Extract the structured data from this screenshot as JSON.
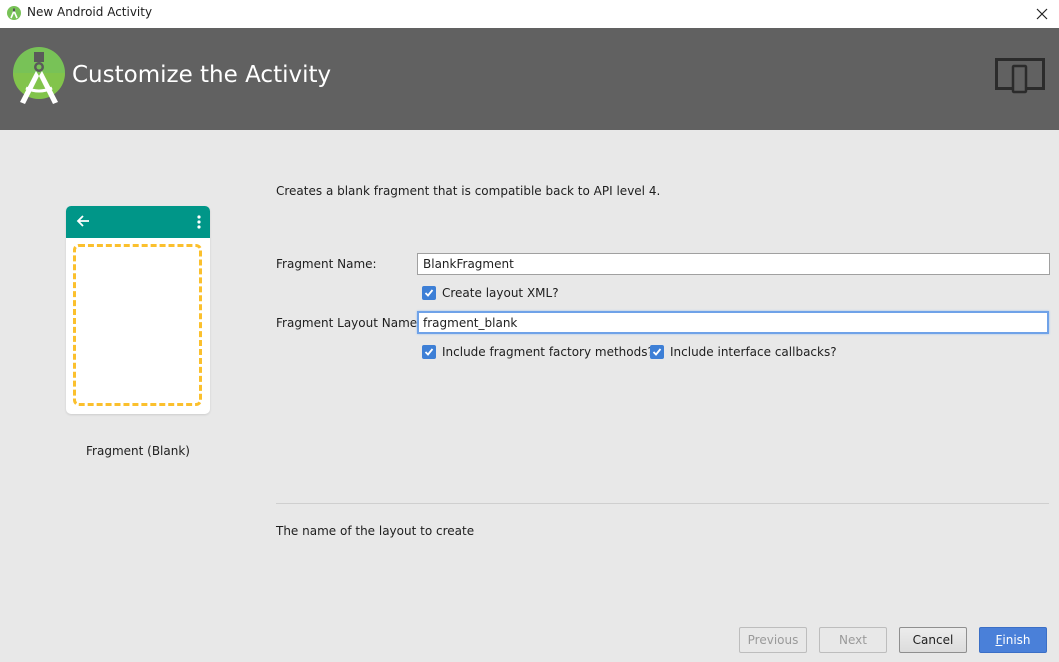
{
  "window": {
    "title": "New Android Activity",
    "icons": {
      "app": "android-studio-icon",
      "close": "close-icon"
    }
  },
  "banner": {
    "heading": "Customize the Activity",
    "icons": {
      "logo": "android-studio-logo-icon",
      "device": "device-form-factor-icon"
    },
    "color": "#616161"
  },
  "preview": {
    "label": "Fragment (Blank)",
    "appbar_color": "#009688",
    "placeholder_color": "#fbc02d",
    "icons": {
      "back": "arrow-back-icon",
      "menu": "more-vert-icon"
    }
  },
  "form": {
    "description": "Creates a blank fragment that is compatible back to API level 4.",
    "fragment_name": {
      "label": "Fragment Name:",
      "value": "BlankFragment"
    },
    "create_layout_xml": {
      "label": "Create layout XML?",
      "checked": true
    },
    "fragment_layout_name": {
      "label": "Fragment Layout Name:",
      "value": "fragment_blank"
    },
    "include_factory_methods": {
      "label": "Include fragment factory methods?",
      "checked": true
    },
    "include_interface_callbacks": {
      "label": "Include interface callbacks?",
      "checked": true
    },
    "help_text": "The name of the layout to create"
  },
  "buttons": {
    "previous": {
      "label": "Previous",
      "enabled": false
    },
    "next": {
      "label": "Next",
      "enabled": false
    },
    "cancel": {
      "label": "Cancel",
      "enabled": true
    },
    "finish": {
      "mnemonic": "F",
      "rest": "inish",
      "enabled": true
    }
  },
  "colors": {
    "accent": "#4a80d9",
    "checkbox": "#3d7fd6",
    "background": "#e8e8e8"
  }
}
